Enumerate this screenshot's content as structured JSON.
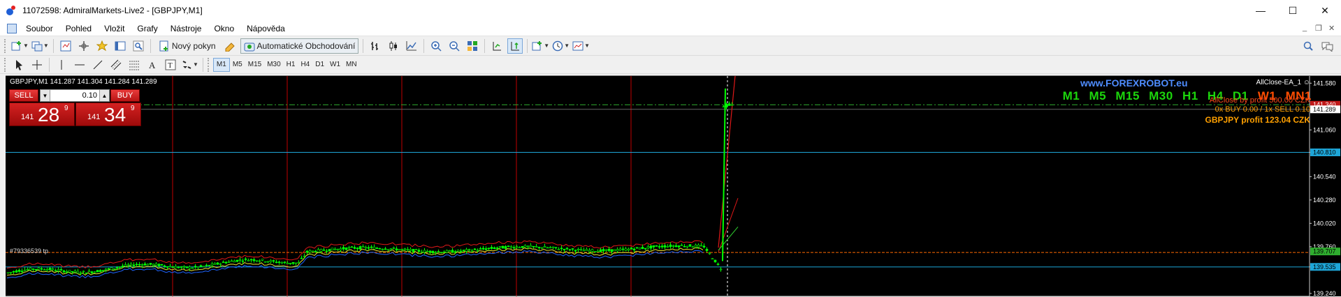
{
  "window": {
    "title": "11072598: AdmiralMarkets-Live2 - [GBPJPY,M1]",
    "controls": [
      "—",
      "☐",
      "✕"
    ]
  },
  "menu": [
    "Soubor",
    "Pohled",
    "Vložit",
    "Grafy",
    "Nástroje",
    "Okno",
    "Nápověda"
  ],
  "mdi_controls": [
    "_",
    "❐",
    "✕"
  ],
  "toolbar": {
    "new_order": "Nový pokyn",
    "auto_trading": "Automatické Obchodování"
  },
  "timeframes": [
    "M1",
    "M5",
    "M15",
    "M30",
    "H1",
    "H4",
    "D1",
    "W1",
    "MN"
  ],
  "active_timeframe": "M1",
  "chart": {
    "symbol_line": "GBPJPY,M1  141.287 141.304 141.284 141.289",
    "ea_name": "AllClose-EA_1 ☺",
    "website": "www.FOREXROBOT.eu",
    "tf_row": [
      "M1",
      "M5",
      "M15",
      "M30",
      "H1",
      "H4",
      "D1",
      "W1",
      "MN1"
    ],
    "allclose_text": "AllClose by profit 500.00 CZK",
    "counts_text": "0x BUY 0.00 / 1x SELL 0.10",
    "profit_text": "GBPJPY profit 123.04 CZK",
    "ticket_text": "#79336539 tp",
    "one_click": {
      "sell_label": "SELL",
      "buy_label": "BUY",
      "volume": "0.10",
      "sell_small": "141",
      "sell_big": "28",
      "sell_sup": "9",
      "buy_small": "141",
      "buy_big": "34",
      "buy_sup": "9"
    },
    "price_axis": [
      "141.580",
      "141.289",
      "141.060",
      "140.810",
      "140.540",
      "140.280",
      "140.020",
      "139.760",
      "139.535",
      "139.240"
    ],
    "price_tags": {
      "current": "141.289",
      "level_blue": "140.810",
      "level_green": "139.707",
      "level_orange": "139.696",
      "level_blue2": "139.535",
      "tp_red": "141.340"
    },
    "colors": {
      "background": "#000000",
      "bull_candle": "#00ff00",
      "grid_red": "#c00000",
      "level_blue": "#1ea6d8",
      "level_orange": "#ff6a00",
      "website": "#4e8cff",
      "tf_green": "#1cd60c",
      "tf_highlight": "#ff4d00",
      "profit": "#ffa000"
    }
  }
}
